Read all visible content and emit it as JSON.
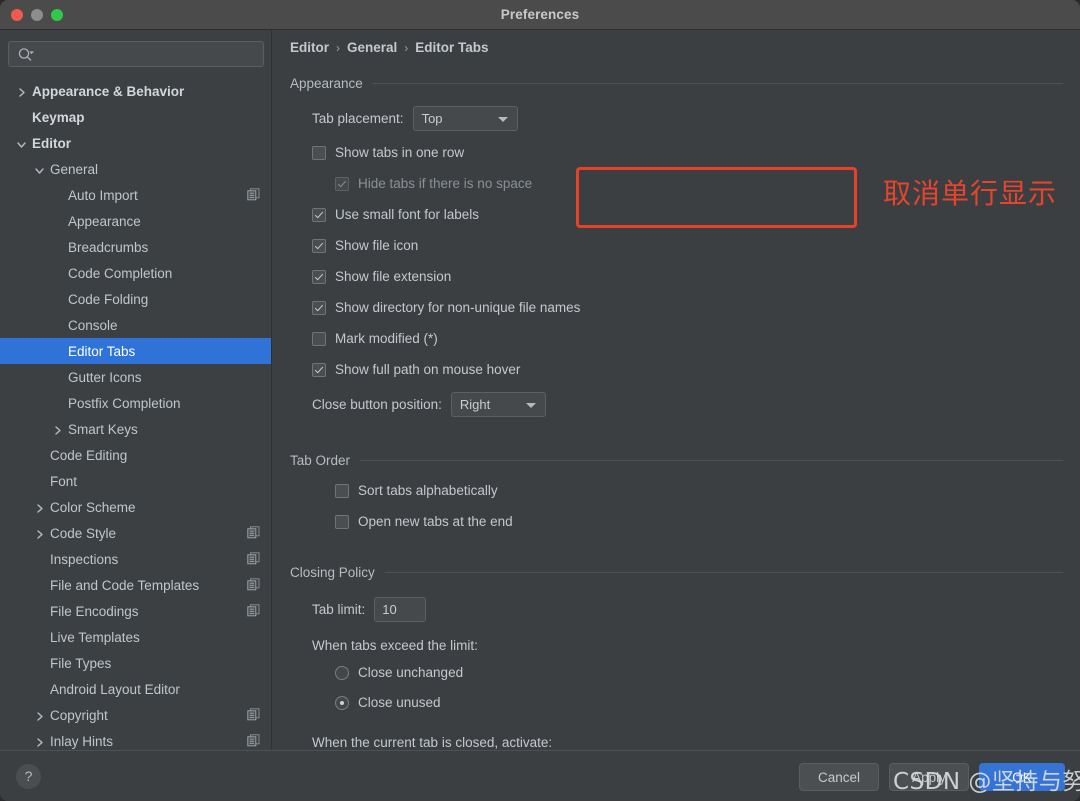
{
  "window": {
    "title": "Preferences",
    "traffic_lights": [
      "close-button",
      "minimize-button",
      "zoom-button"
    ]
  },
  "sidebar": {
    "search": {
      "value": "",
      "placeholder": ""
    },
    "items": [
      {
        "label": "Appearance & Behavior",
        "depth": 0,
        "arrow": "right",
        "bold": true,
        "selected": false,
        "copy": false
      },
      {
        "label": "Keymap",
        "depth": 0,
        "arrow": "none",
        "bold": true,
        "selected": false,
        "copy": false
      },
      {
        "label": "Editor",
        "depth": 0,
        "arrow": "down",
        "bold": true,
        "selected": false,
        "copy": false
      },
      {
        "label": "General",
        "depth": 1,
        "arrow": "down",
        "bold": false,
        "selected": false,
        "copy": false
      },
      {
        "label": "Auto Import",
        "depth": 2,
        "arrow": "none",
        "bold": false,
        "selected": false,
        "copy": true
      },
      {
        "label": "Appearance",
        "depth": 2,
        "arrow": "none",
        "bold": false,
        "selected": false,
        "copy": false
      },
      {
        "label": "Breadcrumbs",
        "depth": 2,
        "arrow": "none",
        "bold": false,
        "selected": false,
        "copy": false
      },
      {
        "label": "Code Completion",
        "depth": 2,
        "arrow": "none",
        "bold": false,
        "selected": false,
        "copy": false
      },
      {
        "label": "Code Folding",
        "depth": 2,
        "arrow": "none",
        "bold": false,
        "selected": false,
        "copy": false
      },
      {
        "label": "Console",
        "depth": 2,
        "arrow": "none",
        "bold": false,
        "selected": false,
        "copy": false
      },
      {
        "label": "Editor Tabs",
        "depth": 2,
        "arrow": "none",
        "bold": false,
        "selected": true,
        "copy": false
      },
      {
        "label": "Gutter Icons",
        "depth": 2,
        "arrow": "none",
        "bold": false,
        "selected": false,
        "copy": false
      },
      {
        "label": "Postfix Completion",
        "depth": 2,
        "arrow": "none",
        "bold": false,
        "selected": false,
        "copy": false
      },
      {
        "label": "Smart Keys",
        "depth": 2,
        "arrow": "right",
        "bold": false,
        "selected": false,
        "copy": false
      },
      {
        "label": "Code Editing",
        "depth": 1,
        "arrow": "none",
        "bold": false,
        "selected": false,
        "copy": false
      },
      {
        "label": "Font",
        "depth": 1,
        "arrow": "none",
        "bold": false,
        "selected": false,
        "copy": false
      },
      {
        "label": "Color Scheme",
        "depth": 1,
        "arrow": "right",
        "bold": false,
        "selected": false,
        "copy": false
      },
      {
        "label": "Code Style",
        "depth": 1,
        "arrow": "right",
        "bold": false,
        "selected": false,
        "copy": true
      },
      {
        "label": "Inspections",
        "depth": 1,
        "arrow": "none",
        "bold": false,
        "selected": false,
        "copy": true
      },
      {
        "label": "File and Code Templates",
        "depth": 1,
        "arrow": "none",
        "bold": false,
        "selected": false,
        "copy": true
      },
      {
        "label": "File Encodings",
        "depth": 1,
        "arrow": "none",
        "bold": false,
        "selected": false,
        "copy": true
      },
      {
        "label": "Live Templates",
        "depth": 1,
        "arrow": "none",
        "bold": false,
        "selected": false,
        "copy": false
      },
      {
        "label": "File Types",
        "depth": 1,
        "arrow": "none",
        "bold": false,
        "selected": false,
        "copy": false
      },
      {
        "label": "Android Layout Editor",
        "depth": 1,
        "arrow": "none",
        "bold": false,
        "selected": false,
        "copy": false
      },
      {
        "label": "Copyright",
        "depth": 1,
        "arrow": "right",
        "bold": false,
        "selected": false,
        "copy": true
      },
      {
        "label": "Inlay Hints",
        "depth": 1,
        "arrow": "right",
        "bold": false,
        "selected": false,
        "copy": true
      }
    ]
  },
  "breadcrumb": {
    "root": "Editor",
    "middle": "General",
    "leaf": "Editor Tabs",
    "separator": "›"
  },
  "appearance": {
    "title": "Appearance",
    "tab_placement_label": "Tab placement:",
    "tab_placement_value": "Top",
    "checkboxes": [
      {
        "label": "Show tabs in one row",
        "checked": false,
        "disabled": false
      },
      {
        "label": "Hide tabs if there is no space",
        "checked": true,
        "disabled": true
      },
      {
        "label": "Use small font for labels",
        "checked": true,
        "disabled": false
      },
      {
        "label": "Show file icon",
        "checked": true,
        "disabled": false
      },
      {
        "label": "Show file extension",
        "checked": true,
        "disabled": false
      },
      {
        "label": "Show directory for non-unique file names",
        "checked": true,
        "disabled": false
      },
      {
        "label": "Mark modified (*)",
        "checked": false,
        "disabled": false
      },
      {
        "label": "Show full path on mouse hover",
        "checked": true,
        "disabled": false
      }
    ],
    "close_button_label": "Close button position:",
    "close_button_value": "Right"
  },
  "tab_order": {
    "title": "Tab Order",
    "checkboxes": [
      {
        "label": "Sort tabs alphabetically",
        "checked": false
      },
      {
        "label": "Open new tabs at the end",
        "checked": false
      }
    ]
  },
  "closing_policy": {
    "title": "Closing Policy",
    "tab_limit_label": "Tab limit:",
    "tab_limit_value": "10",
    "exceed_label": "When tabs exceed the limit:",
    "radios": [
      {
        "label": "Close unchanged",
        "checked": false
      },
      {
        "label": "Close unused",
        "checked": true
      }
    ],
    "activate_label": "When the current tab is closed, activate:"
  },
  "annotation": {
    "text": "取消单行显示",
    "color": "#e4452c"
  },
  "footer": {
    "help_label": "?",
    "cancel_label": "Cancel",
    "apply_label": "Apply",
    "ok_label": "OK"
  },
  "watermark": {
    "text": "CSDN @坚持与努力"
  },
  "colors": {
    "accent": "#2f73d8",
    "primary_button": "#3574d4",
    "annotation_red": "#e8412a"
  }
}
